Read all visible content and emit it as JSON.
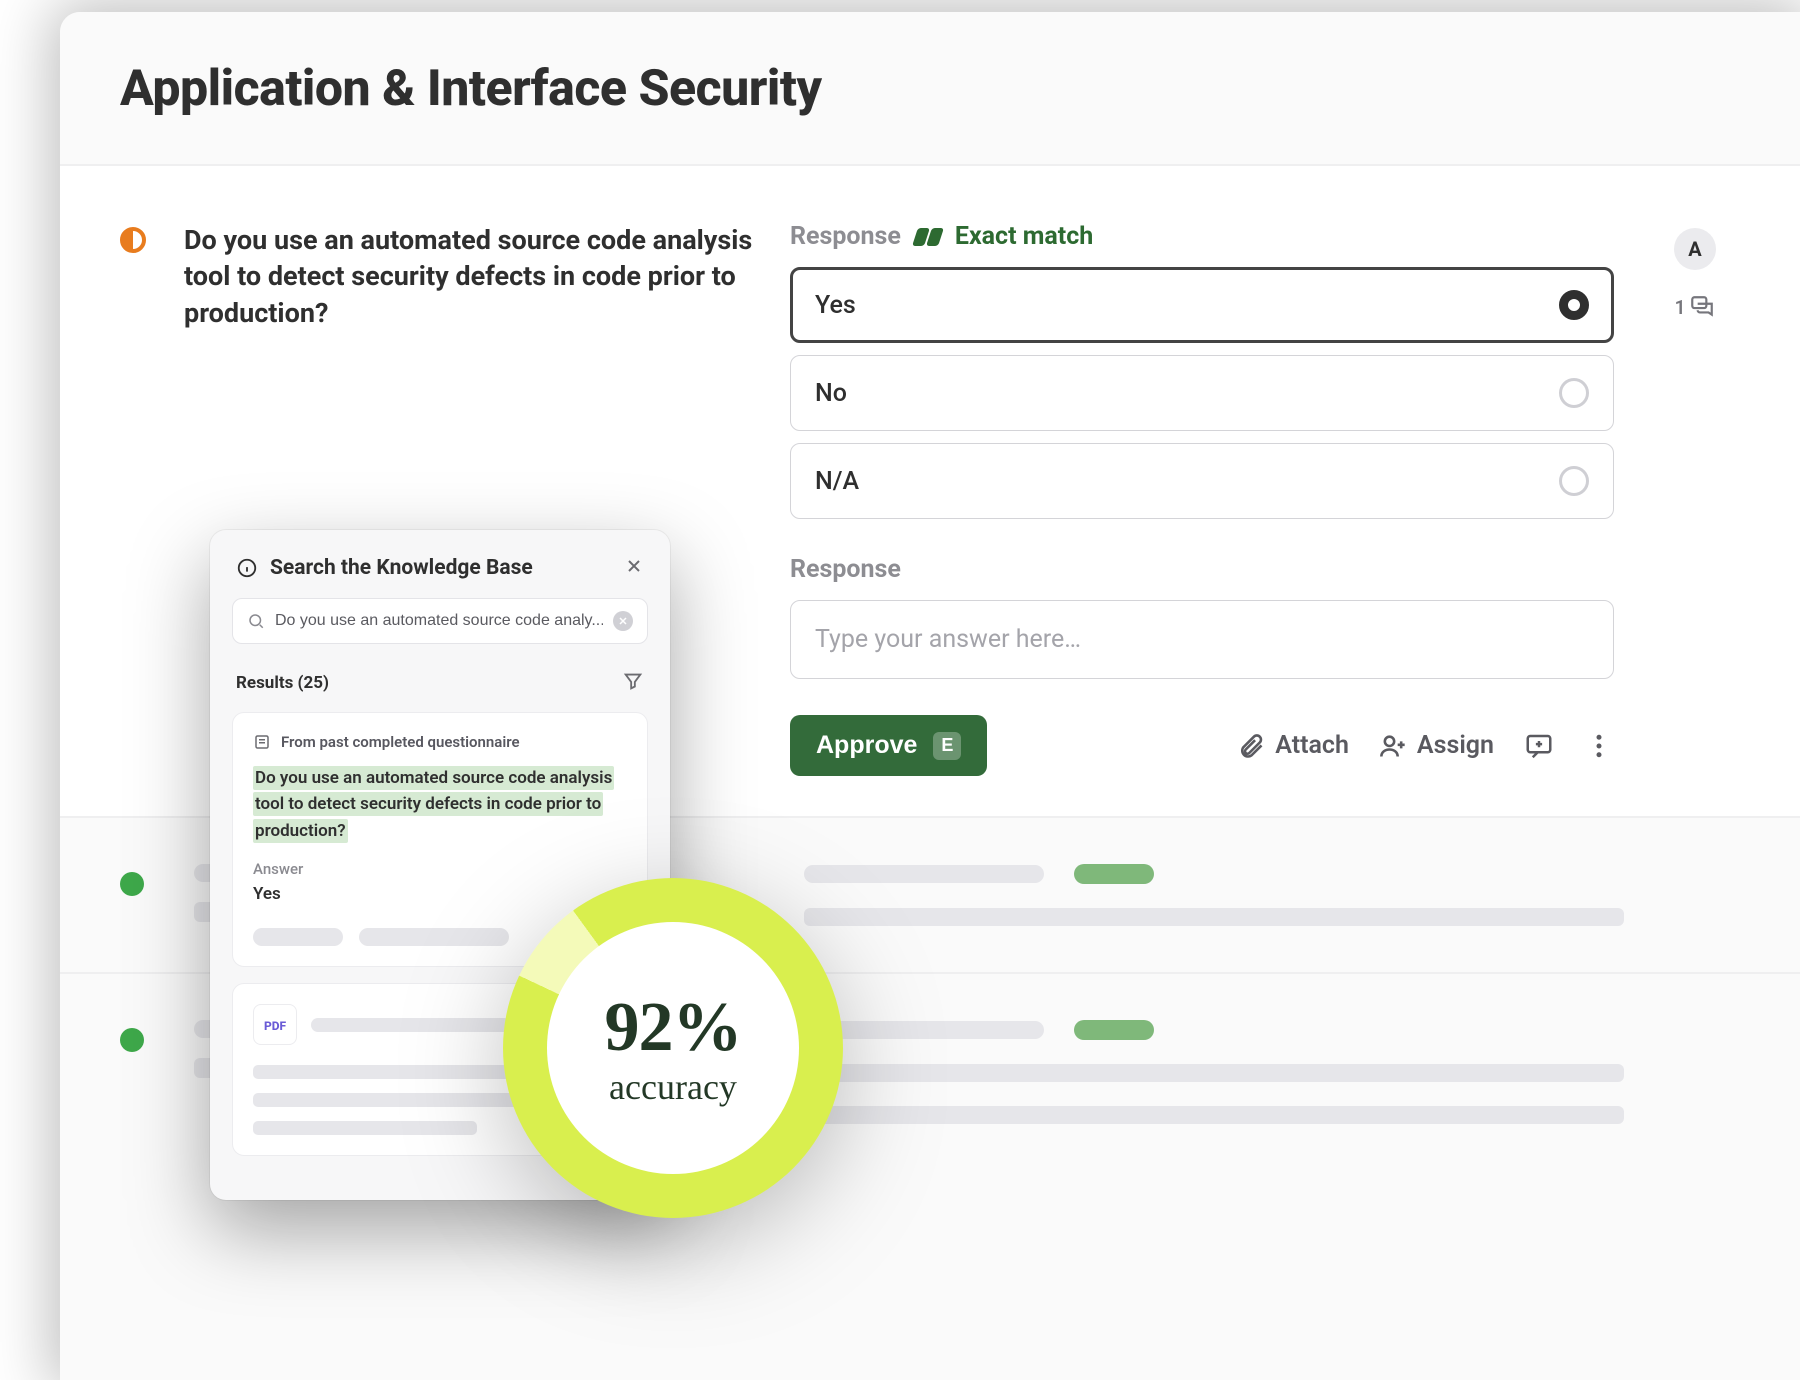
{
  "header": {
    "title": "Application & Interface Security"
  },
  "question": {
    "text": "Do you use an automated source code analysis tool to detect security defects in code prior to production?",
    "response_label": "Response",
    "match_label": "Exact match",
    "options": {
      "yes": "Yes",
      "no": "No",
      "na": "N/A",
      "selected": "yes"
    },
    "free_response_label": "Response",
    "free_response_placeholder": "Type your answer here…",
    "approve_label": "Approve",
    "approve_kbd": "E",
    "attach_label": "Attach",
    "assign_label": "Assign",
    "avatar_initial": "A",
    "comment_count": "1"
  },
  "kb": {
    "title": "Search the Knowledge Base",
    "search_value": "Do you use an automated source code analy...",
    "results_label": "Results (25)",
    "card1": {
      "source_label": "From past completed questionnaire",
      "question": "Do you use an automated source code analysis tool to detect security defects in code prior to production?",
      "answer_label": "Answer",
      "answer_value": "Yes"
    },
    "card2": {
      "file_type": "PDF"
    }
  },
  "accuracy": {
    "percent_label": "92%",
    "sub_label": "accuracy"
  }
}
